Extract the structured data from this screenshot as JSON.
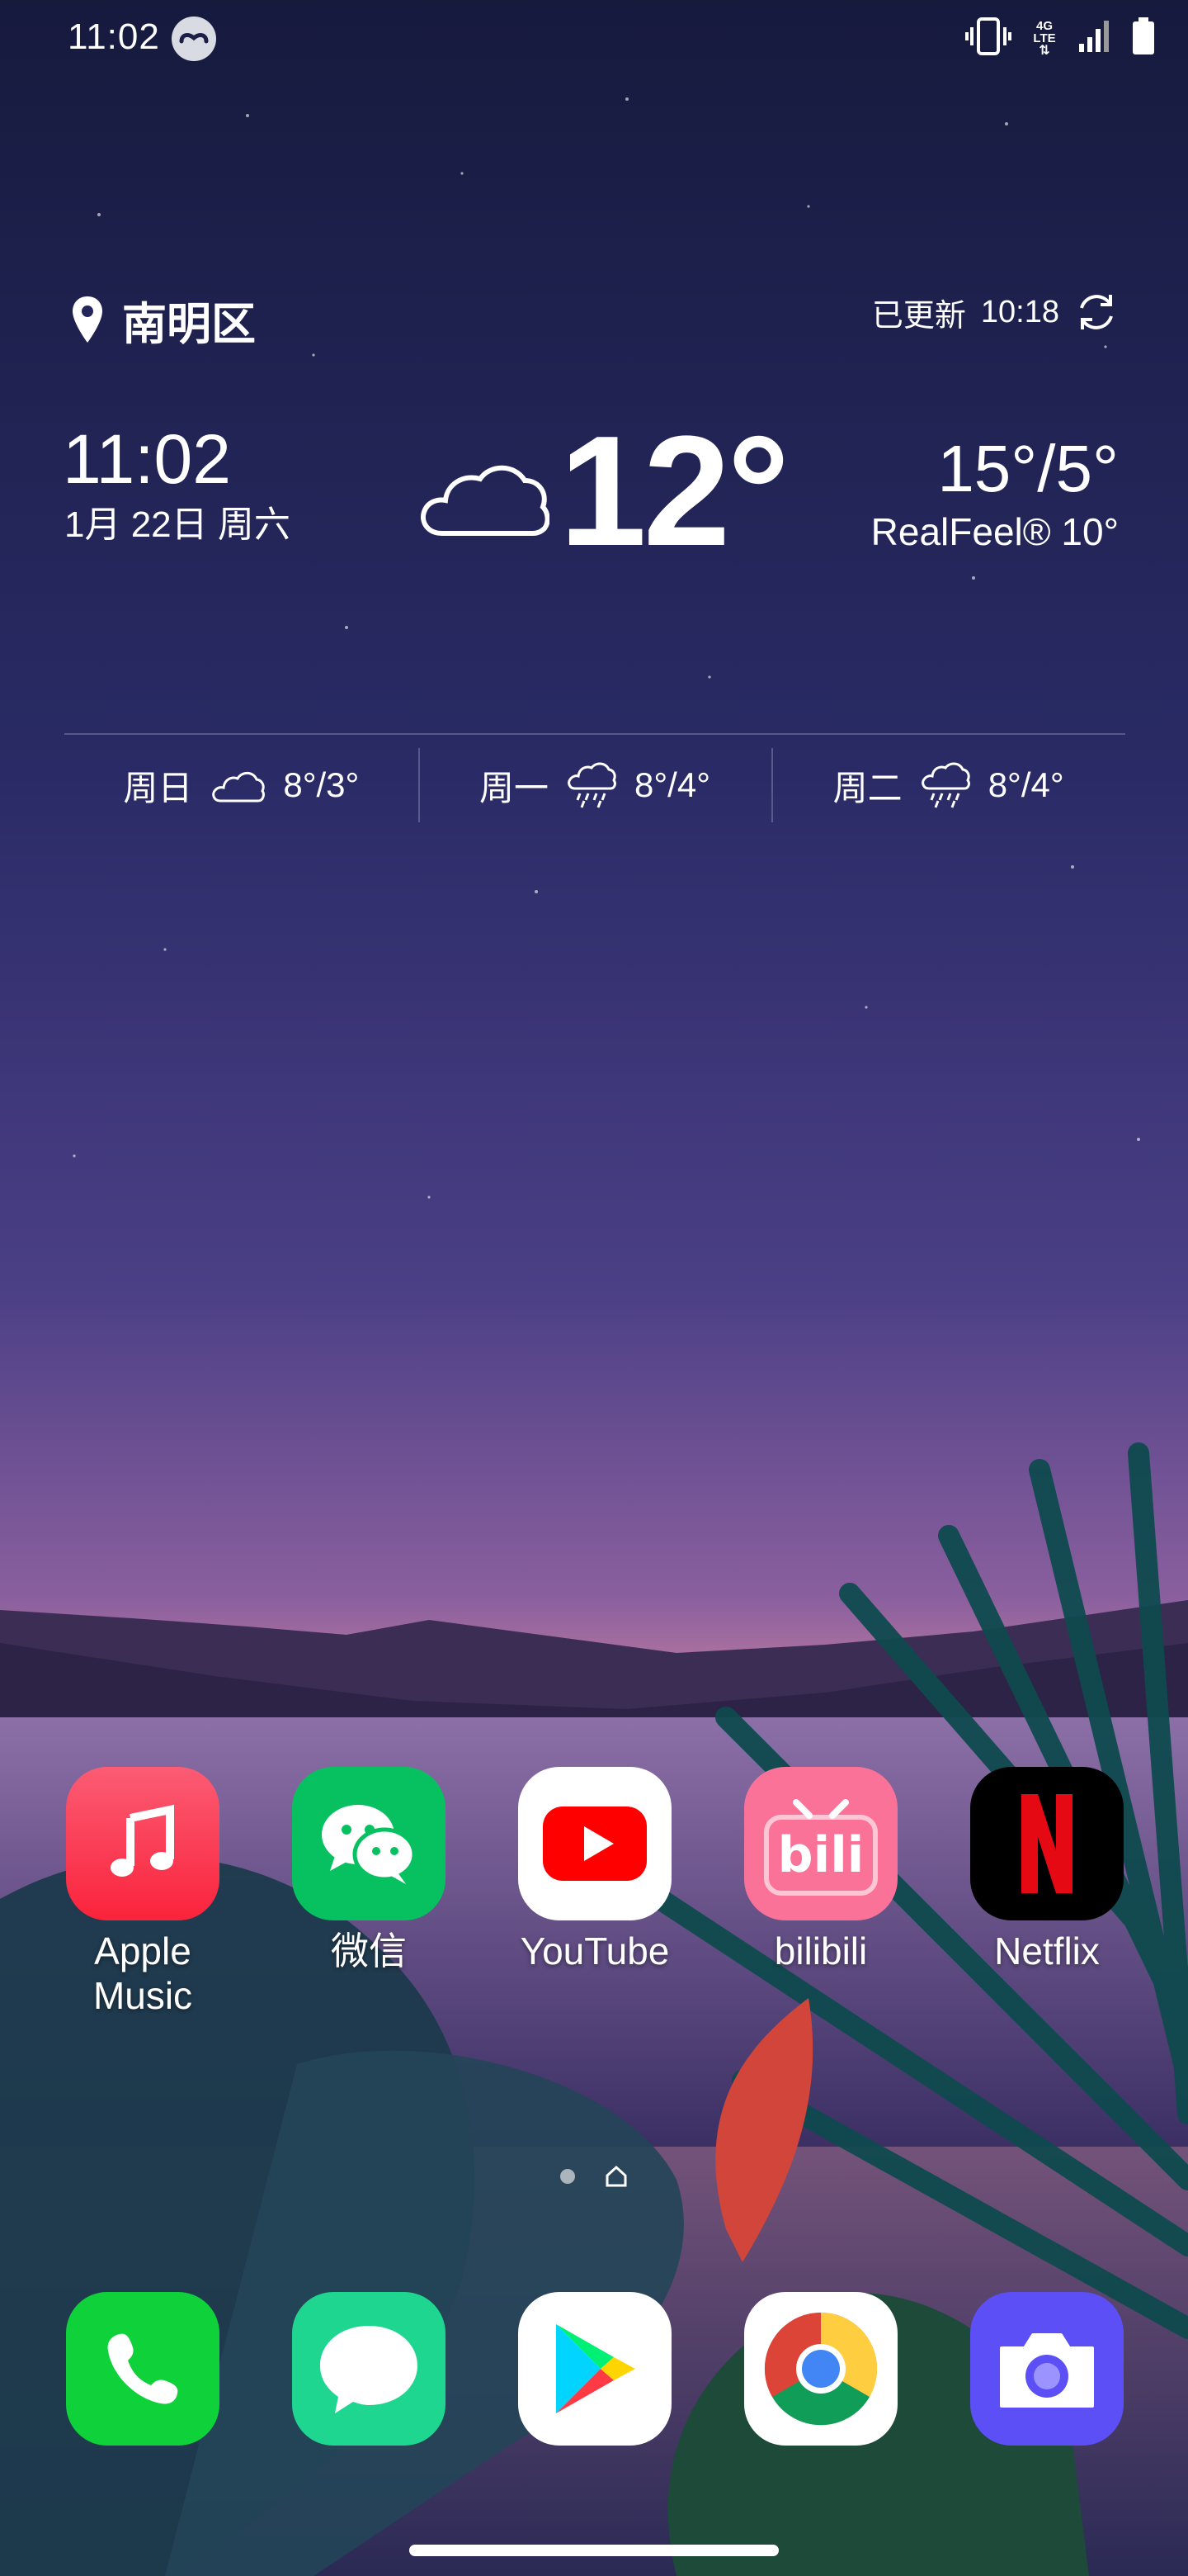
{
  "status_bar": {
    "time": "11:02",
    "network": "4G LTE",
    "icons": [
      "vibrate-icon",
      "network-4g-icon",
      "signal-icon",
      "battery-icon"
    ]
  },
  "weather_widget": {
    "location": "南明区",
    "updated_label": "已更新",
    "updated_time": "10:18",
    "time": "11:02",
    "date": "1月 22日 周六",
    "condition_icon": "cloud-icon",
    "temperature": "12°",
    "high_low": "15°/5°",
    "realfeel": "RealFeel® 10°",
    "forecast": [
      {
        "day": "周日",
        "icon": "cloud-icon",
        "temp": "8°/3°"
      },
      {
        "day": "周一",
        "icon": "rain-icon",
        "temp": "8°/4°"
      },
      {
        "day": "周二",
        "icon": "rain-icon",
        "temp": "8°/4°"
      }
    ]
  },
  "home_apps": [
    {
      "label_line1": "Apple",
      "label_line2": "Music",
      "icon": "apple-music-icon"
    },
    {
      "label_line1": "微信",
      "label_line2": "",
      "icon": "wechat-icon"
    },
    {
      "label_line1": "YouTube",
      "label_line2": "",
      "icon": "youtube-icon"
    },
    {
      "label_line1": "bilibili",
      "label_line2": "",
      "icon": "bilibili-icon"
    },
    {
      "label_line1": "Netflix",
      "label_line2": "",
      "icon": "netflix-icon"
    }
  ],
  "dock_apps": [
    {
      "icon": "phone-icon"
    },
    {
      "icon": "messages-icon"
    },
    {
      "icon": "play-store-icon"
    },
    {
      "icon": "chrome-icon"
    },
    {
      "icon": "camera-icon"
    }
  ],
  "colors": {
    "sky_top": "#1c1f45",
    "sky_bottom": "#c07da0",
    "apple_music": "#fa3f55",
    "wechat": "#07c160",
    "youtube_red": "#ff0000",
    "bilibili": "#fb7299",
    "netflix_red": "#e50914",
    "phone_green": "#0fd23b",
    "messages_green": "#1ed68f",
    "camera_purple": "#5b4ff5"
  }
}
